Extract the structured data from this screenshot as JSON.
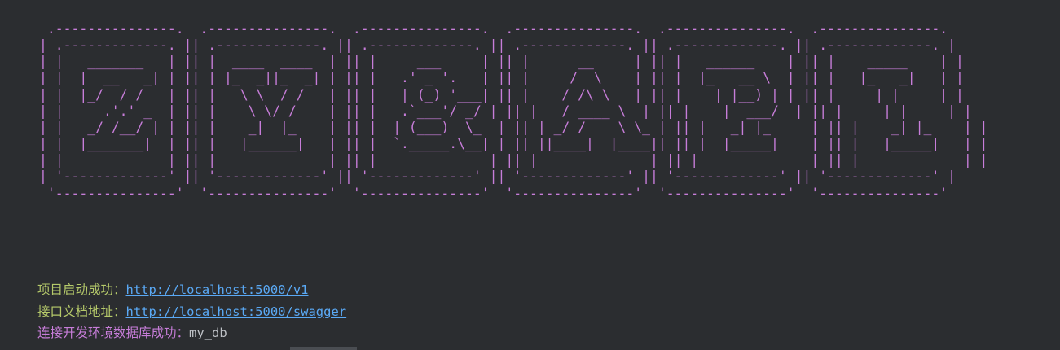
{
  "banner": {
    "text": " .---------------.  .---------------.  .---------------.  .---------------.  .---------------.  .---------------.\n| .-------------. || .-------------. || .-------------. || .-------------. || .-------------. || .-------------. |\n| |   _______   | || |  ____  ____  | || |     ___     | || |      __     | || |   ______    | || |    _____    | |\n| |  |  __   _| | || | |_  _||_  _| | || |   .' _ '.   | || |     /  \\    | || |  |_   __ \\  | || |   |_   _|   | |\n| |  |_/  / /   | || |   \\ \\  / /   | || |   | (_) '___| || |    / /\\ \\   | || |    | |__) | | || |     | |     | |\n| |     .'.' _  | || |    \\ \\/ /    | || |   .`___'/ _/ | || |   / ____ \\  | || |    |  ___/  | || |     | |     | |\n| |   _/ /__/ | | || |    _|  |_    | || |  | (___)  \\_  | || | _/ /    \\ \\_ | || |   _| |_     | || |    _| |_    | |\n| |  |_______|  | || |   |______|   | || |  `._____.\\__| | || ||____|  |____|| || |  |_____|    | || |   |_____|   | |\n| |             | || |              | || |              | || |              | || |              | || |             | |\n| '-------------' || '-------------' || '-------------' || '-------------' || '-------------' || '-------------' |\n '---------------'  '---------------'  '---------------'  '---------------'  '---------------'  '---------------'"
  },
  "log": {
    "line1_label": "项目启动成功：",
    "line1_url": "http://localhost:5000/v1",
    "line2_label": "接口文档地址：",
    "line2_url": "http://localhost:5000/swagger",
    "line3_label": "连接开发环境数据库成功：",
    "line3_value": "my_db"
  },
  "colors": {
    "background": "#2b2d30",
    "banner": "#c77dd9",
    "label_green": "#b5c96a",
    "link": "#5aa9f5",
    "label_purple": "#c77dd9"
  }
}
